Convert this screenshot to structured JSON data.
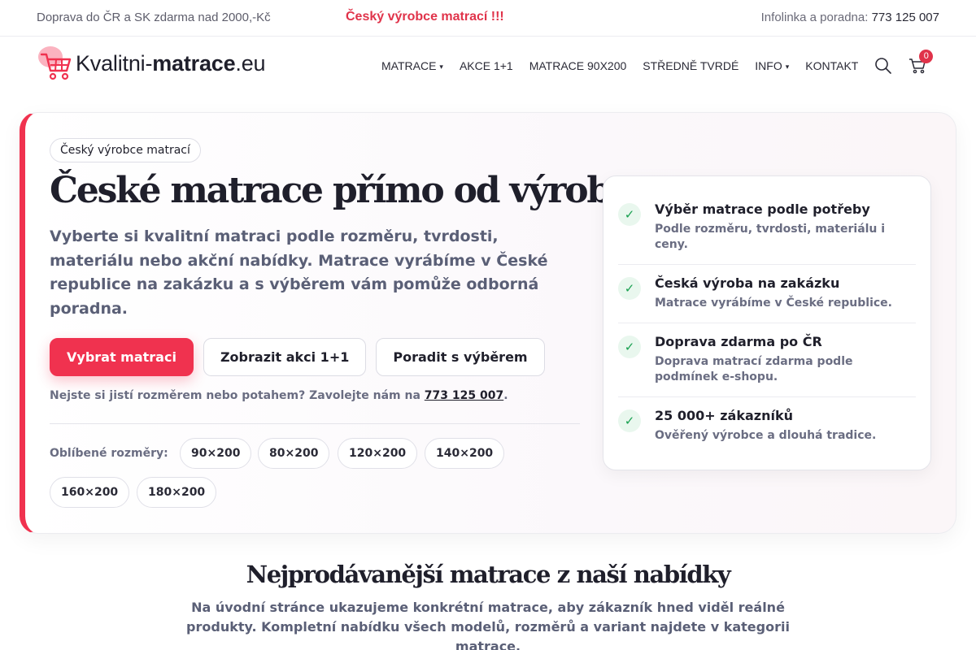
{
  "topbar": {
    "shipping": "Doprava do ČR a SK zdarma nad 2000,-Kč",
    "promo": "Český výrobce matrací !!!",
    "hotline_label": "Infolinka a poradna:",
    "hotline_phone": "773 125 007"
  },
  "logo": {
    "part1": "Kvalitni-",
    "part2": "matrace",
    "part3": ".eu",
    "icon": "shopping-cart-icon"
  },
  "nav": {
    "items": [
      "MATRACE",
      "AKCE 1+1",
      "MATRACE 90X200",
      "STŘEDNĚ TVRDÉ",
      "INFO",
      "KONTAKT"
    ],
    "cart_count": "0"
  },
  "hero": {
    "badge": "Český výrobce matrací",
    "title": "České matrace přímo od výrobce",
    "lead": "Vyberte si kvalitní matraci podle rozměru, tvrdosti, materiálu nebo akční nabídky. Matrace vyrábíme v České republice na zakázku a s výběrem vám pomůže odborná poradna.",
    "buttons": {
      "primary": "Vybrat matraci",
      "secondary": "Zobrazit akci 1+1",
      "tertiary": "Poradit s výběrem"
    },
    "help_text": "Nejste si jistí rozměrem nebo potahem? Zavolejte nám na ",
    "help_phone": "773 125 007",
    "help_end": ".",
    "sizes_label": "Oblíbené rozměry:",
    "sizes": [
      "90×200",
      "80×200",
      "120×200",
      "140×200",
      "160×200",
      "180×200"
    ]
  },
  "features": [
    {
      "title": "Výběr matrace podle potřeby",
      "desc": "Podle rozměru, tvrdosti, materiálu i ceny."
    },
    {
      "title": "Česká výroba na zakázku",
      "desc": "Matrace vyrábíme v České republice."
    },
    {
      "title": "Doprava zdarma po ČR",
      "desc": "Doprava matrací zdarma podle podmínek e-shopu."
    },
    {
      "title": "25 000+ zákazníků",
      "desc": "Ověřený výrobce a dlouhá tradice."
    }
  ],
  "section": {
    "title": "Nejprodávanější matrace z naší nabídky",
    "text": "Na úvodní stránce ukazujeme konkrétní matrace, aby zákazník hned viděl reálné produkty. Kompletní nabídku všech modelů, rozměrů a variant najdete v kategorii matrace."
  },
  "colors": {
    "accent": "#f0324f",
    "promo_red": "#e0334a",
    "check_green": "#18a050"
  }
}
